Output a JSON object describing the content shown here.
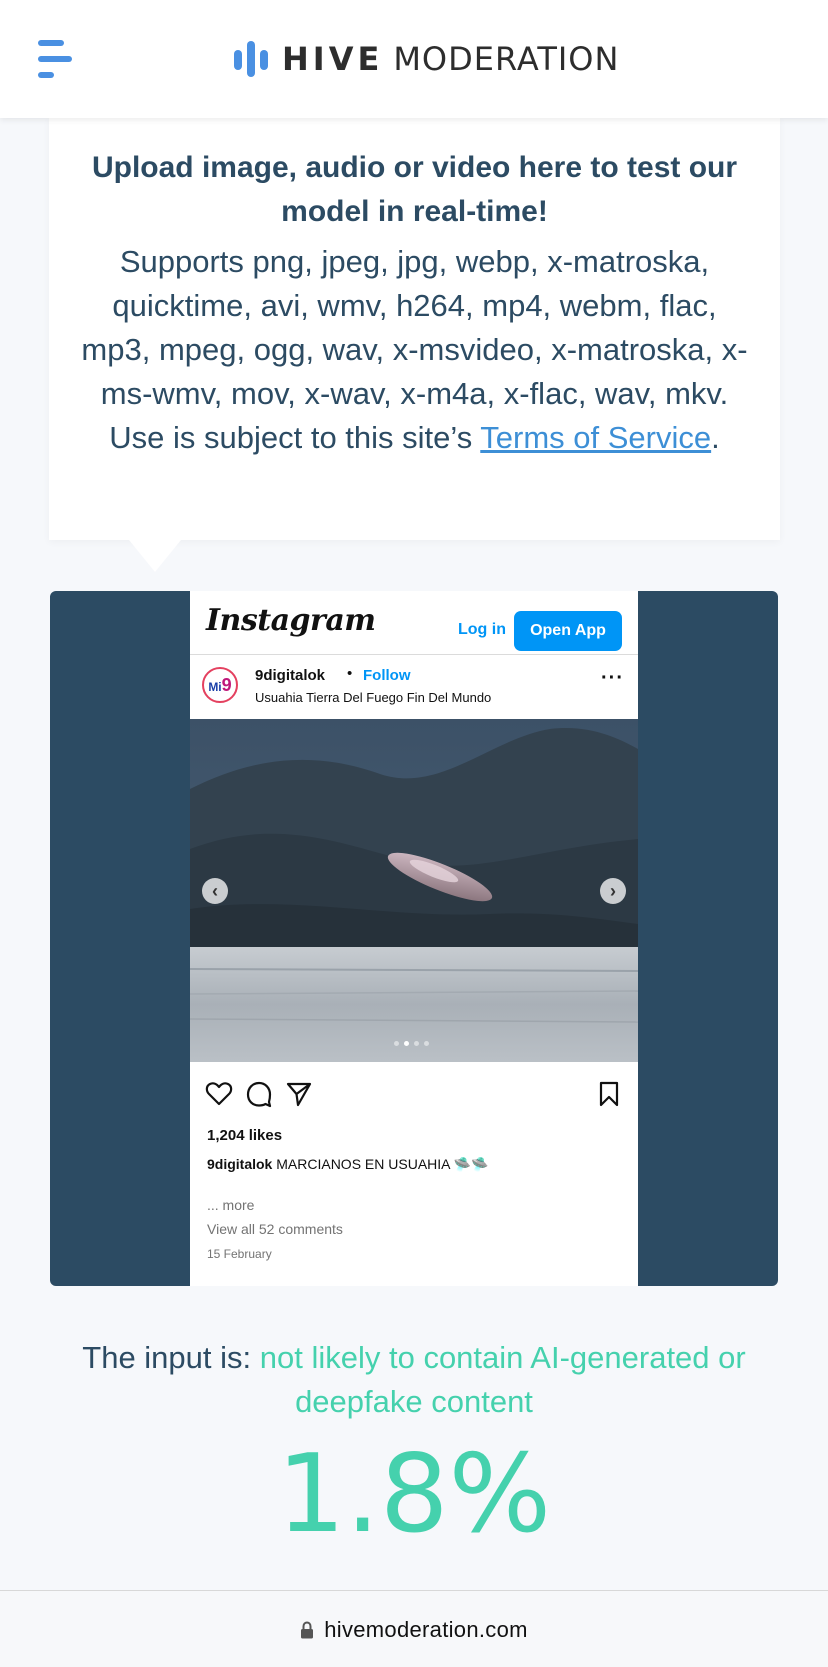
{
  "header": {
    "logo_primary": "HIVE",
    "logo_secondary": "MODERATION",
    "brand_color": "#4a90e2"
  },
  "info": {
    "title": "Upload image, audio or video here to test our model in real-time!",
    "supports_text": "Supports png, jpeg, jpg, webp, x-matroska, quicktime, avi, wmv, h264, mp4, webm, flac, mp3, mpeg, ogg, wav, x-msvideo, x-matroska, x-ms-wmv, mov, x-wav, x-m4a, x-flac, wav, mkv. Use is subject to this site’s ",
    "terms_link": "Terms of Service",
    "trailing": "."
  },
  "instagram": {
    "logo": "Instagram",
    "login_label": "Log in",
    "open_app_label": "Open App",
    "avatar_text": "Mi",
    "avatar_digit": "9",
    "username": "9digitalok",
    "follow_label": "Follow",
    "location": "Usuahia Tierra Del Fuego Fin Del Mundo",
    "more_menu": "···",
    "likes": "1,204 likes",
    "caption_user": "9digitalok",
    "caption_text": " MARCIANOS EN USUAHIA 🛸🛸",
    "more_text": "... more",
    "comments_text": "View all 52 comments",
    "date": "15 February",
    "carousel_prev": "‹",
    "carousel_next": "›"
  },
  "result": {
    "prefix": "The input is: ",
    "verdict": "not likely to contain AI-generated or deepfake content",
    "percentage": "1.8%",
    "accent_color": "#45d1ad"
  },
  "browser": {
    "url": "hivemoderation.com"
  }
}
